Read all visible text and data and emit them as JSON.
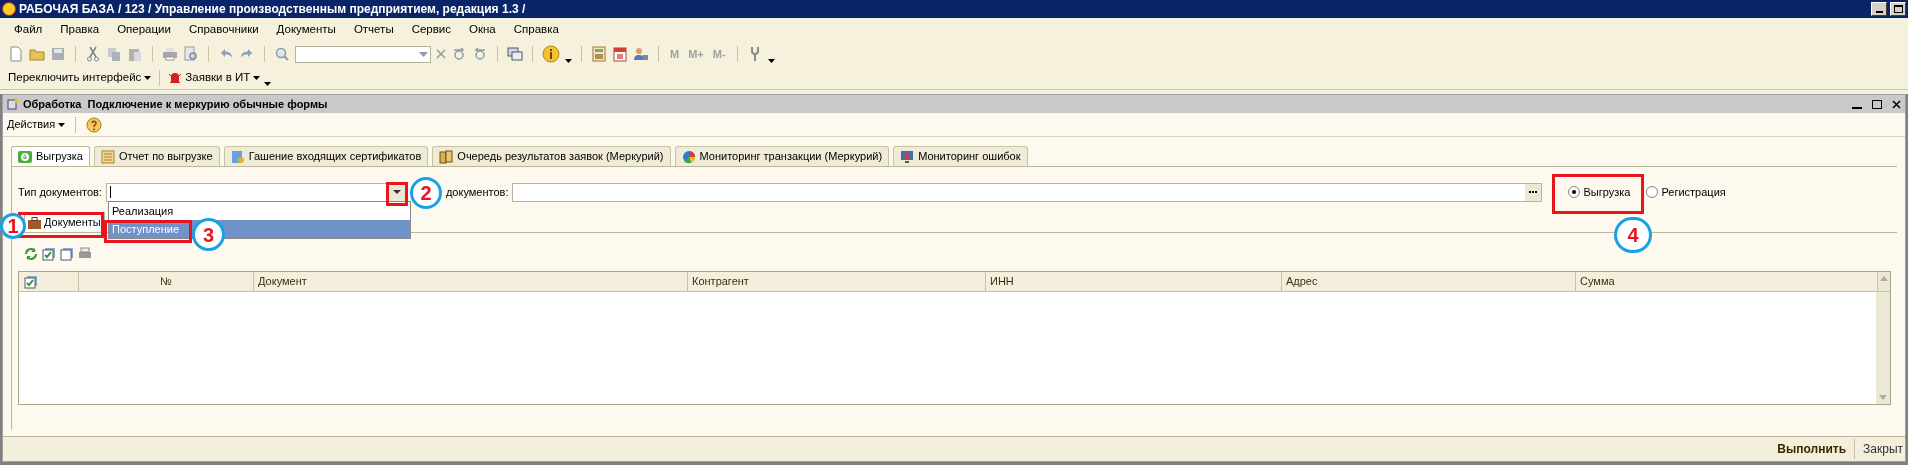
{
  "window": {
    "title": "РАБОЧАЯ БАЗА / 123 /  Управление производственным предприятием, редакция 1.3 /"
  },
  "menu": [
    "Файл",
    "Правка",
    "Операции",
    "Справочники",
    "Документы",
    "Отчеты",
    "Сервис",
    "Окна",
    "Справка"
  ],
  "memory_buttons": [
    "M",
    "M+",
    "M-"
  ],
  "toolbar2": [
    {
      "label": "Переключить интерфейс",
      "kind": "plain"
    },
    {
      "label": "Заявки в ИТ",
      "kind": "alarm"
    }
  ],
  "form": {
    "title": "Обработка  Подключение к меркурию обычные формы",
    "actions": "Действия",
    "tabs": [
      {
        "label": "Выгрузка",
        "selected": true,
        "kind": "download"
      },
      {
        "label": "Отчет по выгрузке",
        "selected": false,
        "kind": "report"
      },
      {
        "label": "Гашение входящих сертификатов",
        "selected": false,
        "kind": "certificate"
      },
      {
        "label": "Очередь результатов заявок (Меркурий)",
        "selected": false,
        "kind": "queue"
      },
      {
        "label": "Мониторинг транзакции (Меркурий)",
        "selected": false,
        "kind": "pie"
      },
      {
        "label": "Мониторинг ошибок",
        "selected": false,
        "kind": "monitor"
      }
    ],
    "doc_type_label": "Тип документов:",
    "documents_label": "документов:",
    "dropdown_options": [
      {
        "label": "Реализация",
        "selected": false
      },
      {
        "label": "Поступление",
        "selected": true
      }
    ],
    "mode_options": [
      {
        "label": "Выгрузка",
        "selected": true
      },
      {
        "label": "Регистрация",
        "selected": false
      }
    ],
    "inner_tab": "Документы",
    "table": {
      "columns": [
        "№",
        "Документ",
        "Контрагент",
        "ИНН",
        "Адрес",
        "Сумма"
      ]
    },
    "buttons": [
      {
        "label": "Выполнить",
        "default": true
      },
      {
        "label": "Закрыт",
        "default": false
      }
    ]
  },
  "callouts": [
    "1",
    "2",
    "3",
    "4"
  ]
}
